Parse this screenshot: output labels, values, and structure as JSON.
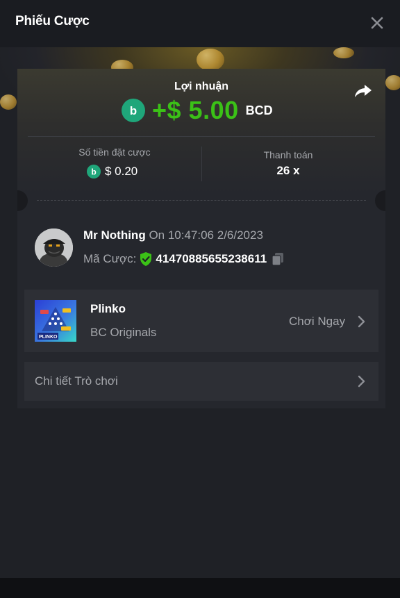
{
  "header": {
    "title": "Phiếu Cược"
  },
  "summary": {
    "profit_label": "Lợi nhuận",
    "profit_amount": "+$ 5.00",
    "currency": "BCD",
    "bet_amount_label": "Số tiền đặt cược",
    "bet_amount": "$ 0.20",
    "payout_label": "Thanh toán",
    "payout": "26 x"
  },
  "bet": {
    "username": "Mr Nothing",
    "time": "On 10:47:06 2/6/2023",
    "bet_id_label": "Mã Cược:",
    "bet_id": "41470885655238611"
  },
  "game": {
    "name": "Plinko",
    "provider": "BC Originals",
    "play_label": "Chơi Ngay",
    "thumb_text": "PLINKO"
  },
  "details": {
    "label": "Chi tiết Trò chơi"
  },
  "colors": {
    "profit_green": "#3bc117",
    "coin_green": "#1fa67a",
    "background": "#1f2126",
    "row_background": "#2d2f35"
  },
  "icons": [
    "close-icon",
    "share-icon",
    "bc-coin-icon",
    "shield-check-icon",
    "copy-icon",
    "chevron-right-icon"
  ]
}
